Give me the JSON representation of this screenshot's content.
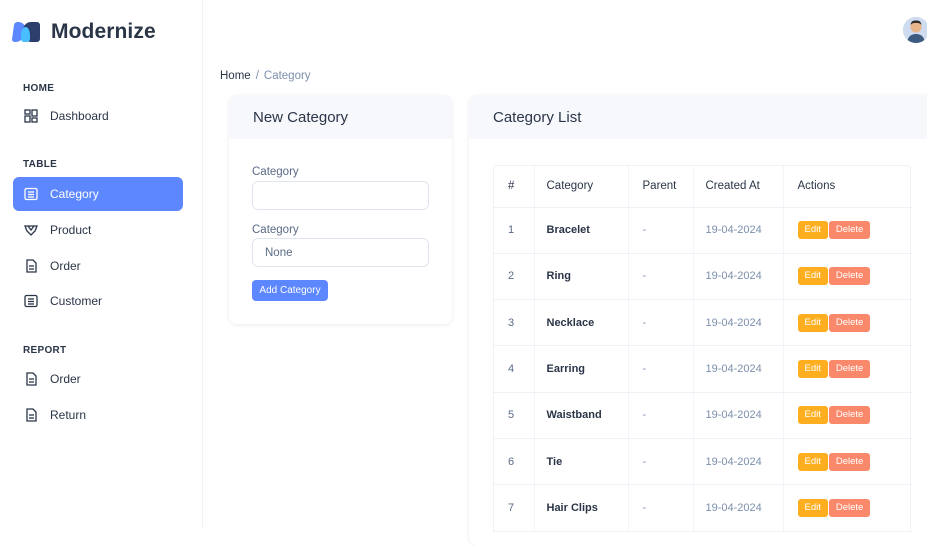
{
  "brand": {
    "name": "Modernize",
    "logo_icon": "modernize-logo-icon"
  },
  "sidebar": {
    "sections": [
      {
        "title": "HOME"
      },
      {
        "title": "TABLE"
      },
      {
        "title": "REPORT"
      }
    ],
    "items": [
      {
        "label": "Dashboard",
        "icon": "dashboard-grid-icon"
      },
      {
        "label": "Category",
        "icon": "list-box-icon",
        "active": true
      },
      {
        "label": "Product",
        "icon": "gem-icon"
      },
      {
        "label": "Order",
        "icon": "file-text-icon"
      },
      {
        "label": "Customer",
        "icon": "list-box-icon"
      },
      {
        "label": "Order",
        "icon": "file-text-icon"
      },
      {
        "label": "Return",
        "icon": "file-text-icon"
      }
    ]
  },
  "header": {
    "avatar_icon": "user-avatar"
  },
  "breadcrumb": {
    "home": "Home",
    "separator": "/",
    "current": "Category"
  },
  "new_category": {
    "title": "New Category",
    "name_label": "Category",
    "name_value": "",
    "parent_label": "Category",
    "parent_value": "None",
    "submit_label": "Add Category"
  },
  "category_list": {
    "title": "Category List",
    "columns": [
      "#",
      "Category",
      "Parent",
      "Created At",
      "Actions"
    ],
    "edit_label": "Edit",
    "delete_label": "Delete",
    "rows": [
      {
        "num": "1",
        "category": "Bracelet",
        "parent": "-",
        "created_at": "19-04-2024"
      },
      {
        "num": "2",
        "category": "Ring",
        "parent": "-",
        "created_at": "19-04-2024"
      },
      {
        "num": "3",
        "category": "Necklace",
        "parent": "-",
        "created_at": "19-04-2024"
      },
      {
        "num": "4",
        "category": "Earring",
        "parent": "-",
        "created_at": "19-04-2024"
      },
      {
        "num": "5",
        "category": "Waistband",
        "parent": "-",
        "created_at": "19-04-2024"
      },
      {
        "num": "6",
        "category": "Tie",
        "parent": "-",
        "created_at": "19-04-2024"
      },
      {
        "num": "7",
        "category": "Hair Clips",
        "parent": "-",
        "created_at": "19-04-2024"
      }
    ]
  },
  "colors": {
    "primary": "#5d87ff",
    "warning": "#ffae1f",
    "danger": "#fa896b",
    "text": "#2a3547",
    "muted": "#7c8fac"
  }
}
